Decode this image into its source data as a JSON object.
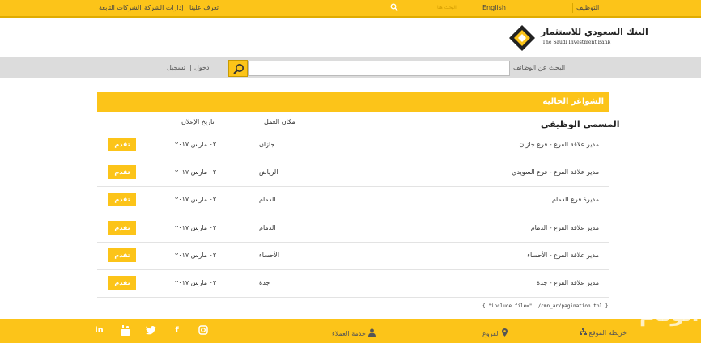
{
  "topbar": {
    "jobs": "التوظيف",
    "language": "English",
    "search_placeholder": "البحث هنا",
    "links": [
      "الشركات التابعة",
      "إدارات الشركة",
      "تعرف علينا"
    ]
  },
  "header": {
    "logo_ar": "البنك السعودي للاستثمار",
    "logo_en": "The Saudi Investment Bank"
  },
  "searchbar": {
    "label": "البحث عن الوظائف",
    "input_value": "",
    "login": "دخول",
    "separator": "|",
    "register": "تسجيل"
  },
  "jobs": {
    "heading": "الشواغر الحالية",
    "columns": {
      "title": "المسمى الوظيفي",
      "location": "مكان العمل",
      "date": "تاريخ الإعلان"
    },
    "apply_label": "تقدم",
    "rows": [
      {
        "title": "مدير علاقة الفرع - فرع جازان",
        "location": "جازان",
        "date": "٠٢ مارس ٢٠١٧"
      },
      {
        "title": "مدير علاقة الفرع - فرع السويدي",
        "location": "الرياض",
        "date": "٠٢ مارس ٢٠١٧"
      },
      {
        "title": "مديرة فرع الدمام",
        "location": "الدمام",
        "date": "٠٢ مارس ٢٠١٧"
      },
      {
        "title": "مدير علاقة الفرع - الدمام",
        "location": "الدمام",
        "date": "٠٢ مارس ٢٠١٧"
      },
      {
        "title": "مدير علاقة الفرع - الأحساء",
        "location": "الأحساء",
        "date": "٠٢ مارس ٢٠١٧"
      },
      {
        "title": "مدير علاقة الفرع - جدة",
        "location": "جدة",
        "date": "٠٢ مارس ٢٠١٧"
      }
    ],
    "pagination_note": "{ \"include file=\"../cmn_ar/pagination.tpl }"
  },
  "footer": {
    "sitemap": "خريطة الموقع",
    "branches": "الفروع",
    "customer_service": "خدمة العملاء",
    "social_icons": [
      "instagram-icon",
      "facebook-icon",
      "twitter-icon",
      "youtube-icon",
      "linkedin-icon"
    ]
  },
  "watermark": "الوئام",
  "colors": {
    "accent": "#fcc419",
    "grey_bar": "#dcdcdc"
  }
}
